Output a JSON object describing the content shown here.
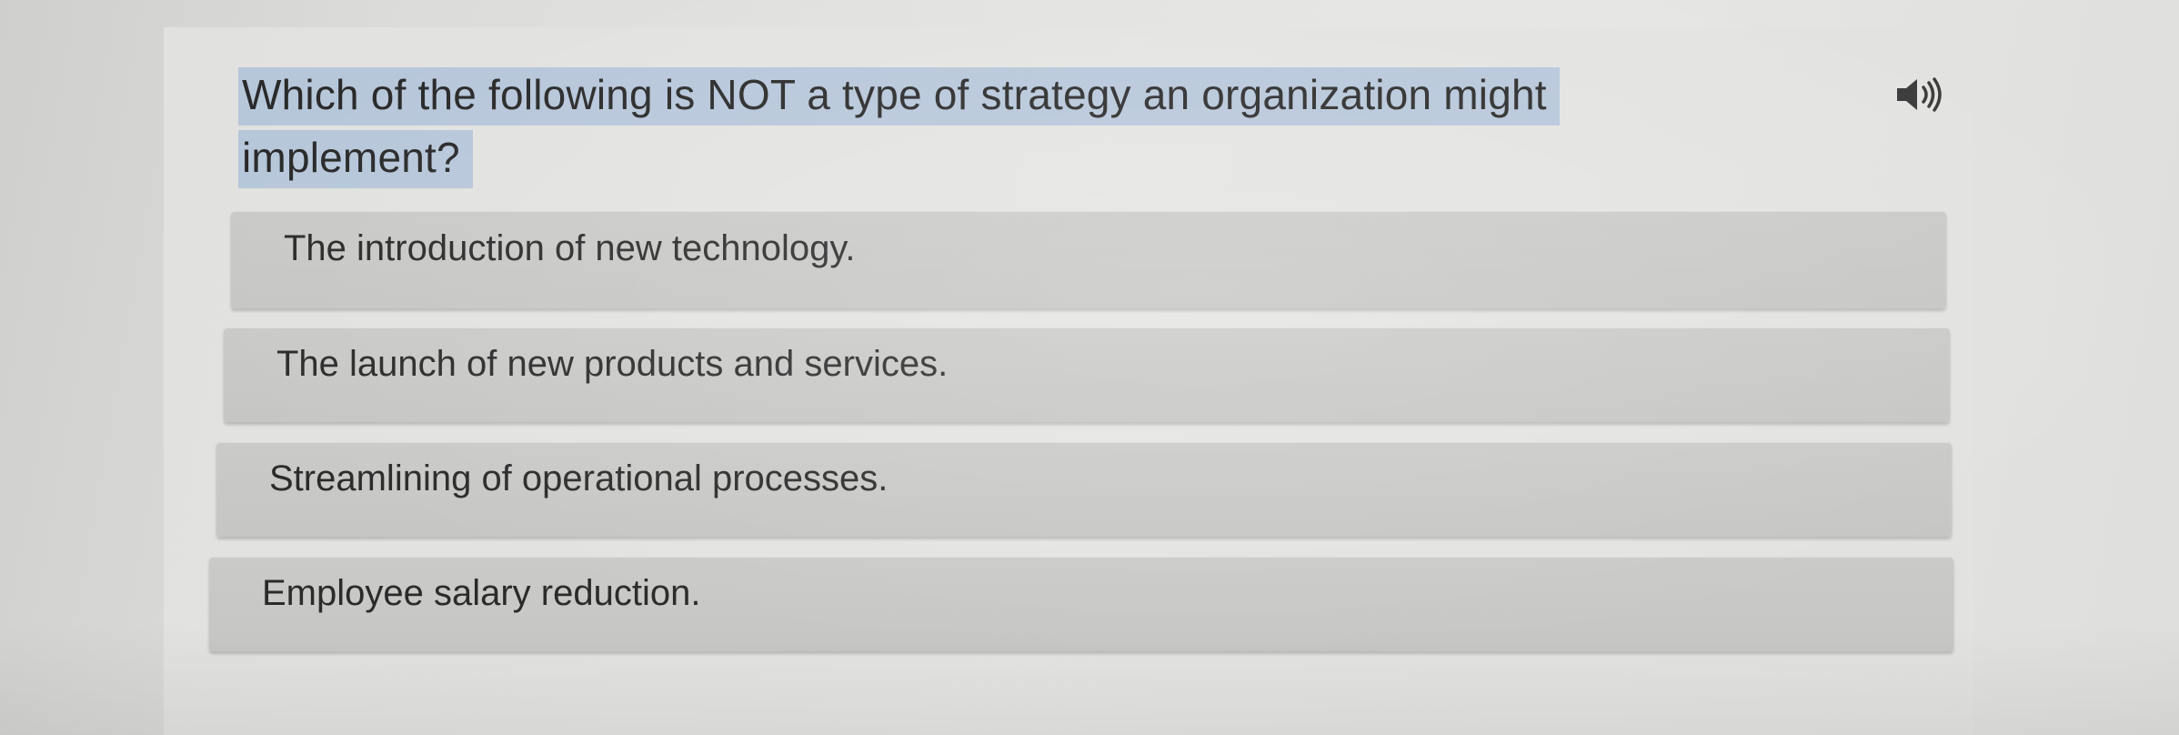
{
  "question": {
    "text": "Which of the following is NOT a type of strategy an organization might implement?"
  },
  "audio": {
    "icon": "speaker-icon"
  },
  "options": [
    {
      "label": "The introduction of new technology."
    },
    {
      "label": "The launch of new products and services."
    },
    {
      "label": "Streamlining of operational processes."
    },
    {
      "label": "Employee salary reduction."
    }
  ],
  "colors": {
    "highlight": "#b7c7da",
    "option_bg": "#c8c8c6",
    "text": "#2b2b2b"
  }
}
